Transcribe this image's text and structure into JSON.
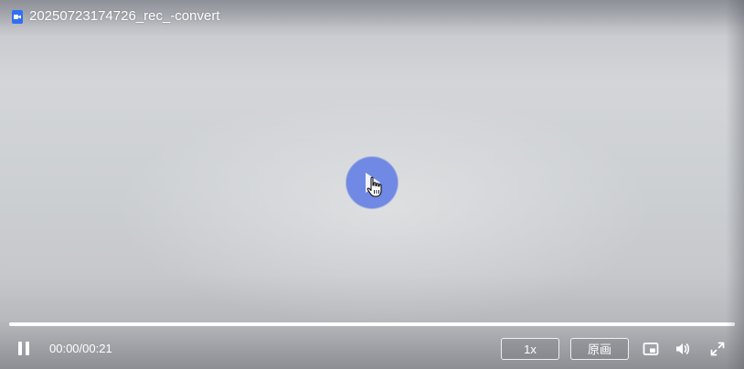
{
  "window": {
    "file_title": "20250723174726_rec_-convert"
  },
  "player": {
    "progress_fraction": 1.0,
    "time": {
      "current": "00:00",
      "separator": "/",
      "total": "00:21"
    },
    "speed_label": "1x",
    "quality_label": "原画",
    "play_button_color": "#6f89e4"
  },
  "icons": {
    "file": "video-file-icon",
    "play": "play-icon",
    "cursor": "hand-cursor-icon",
    "pause": "pause-icon",
    "pip": "picture-in-picture-icon",
    "volume": "volume-icon",
    "fullscreen": "fullscreen-icon"
  }
}
